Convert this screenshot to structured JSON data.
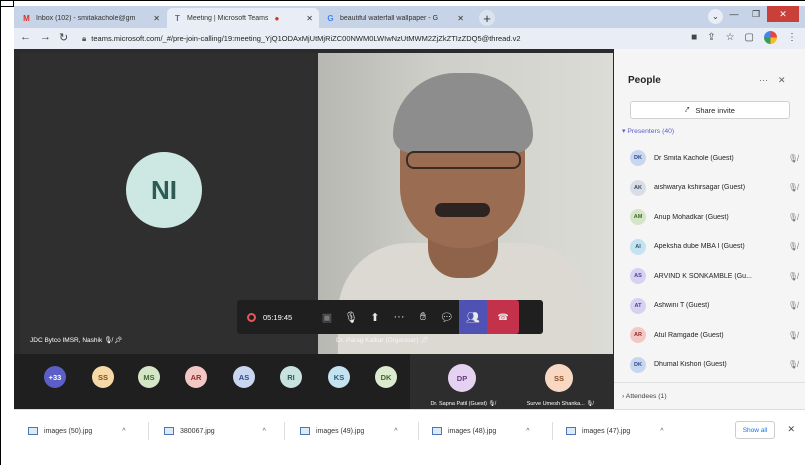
{
  "browser": {
    "tabs": [
      {
        "title": "Inbox (102) - smitakachole@gm",
        "icon": "gmail-icon",
        "color": "#d93025"
      },
      {
        "title": "Meeting | Microsoft Teams",
        "icon": "teams-icon",
        "color": "#5b5fc7",
        "active": true
      },
      {
        "title": "beautiful waterfall wallpaper - G",
        "icon": "google-icon",
        "color": "#4285f4"
      }
    ],
    "new_tab": "+",
    "url": "teams.microsoft.com/_#/pre-join-calling/19:meeting_YjQ1ODAxMjUtMjRiZC00NWM0LWIwNzUtMWM2ZjZkZTIzZDQ5@thread.v2"
  },
  "stage": {
    "main_avatar_initials": "NI",
    "left_tile_label": "JDC Bytco IMSR, Nashik",
    "right_tile_label": "Dr. Parag Kalkar (Organiser)"
  },
  "callbar": {
    "timer": "05:19:45"
  },
  "gallery": {
    "overflow": "+33",
    "avatars": [
      {
        "initials": "SS",
        "bg": "#f6d9a7",
        "fg": "#7a4f0b"
      },
      {
        "initials": "MS",
        "bg": "#d5e6c8",
        "fg": "#3f6b2c"
      },
      {
        "initials": "AR",
        "bg": "#f3c7c4",
        "fg": "#8a2f2a"
      },
      {
        "initials": "AS",
        "bg": "#c9d6ef",
        "fg": "#2c4a8a"
      },
      {
        "initials": "RI",
        "bg": "#c8e3df",
        "fg": "#2f5a54"
      },
      {
        "initials": "KS",
        "bg": "#c4e2ef",
        "fg": "#2a5a70"
      },
      {
        "initials": "DK",
        "bg": "#dcebcf",
        "fg": "#44662b"
      }
    ],
    "tiles": [
      {
        "initials": "DP",
        "name": "Dr. Sapna Patil (Guest)",
        "bg": "#e5d2f0",
        "fg": "#6a3c85"
      },
      {
        "initials": "SS",
        "name": "Surve Umesh Shanka...",
        "bg": "#f8d8c3",
        "fg": "#8a4a1e"
      }
    ]
  },
  "panel": {
    "title": "People",
    "more": "···",
    "close": "✕",
    "share_invite": "Share invite",
    "presenters_label": "Presenters (40)",
    "attendees_label": "Attendees (1)",
    "people": [
      {
        "initials": "DK",
        "name": "Dr Smita Kachole (Guest)",
        "bg": "#c9d6ef",
        "fg": "#2c4a8a"
      },
      {
        "initials": "AK",
        "name": "aishwarya kshirsagar (Guest)",
        "bg": "#d9dde6",
        "fg": "#3b4a63"
      },
      {
        "initials": "AM",
        "name": "Anup Mohadkar (Guest)",
        "bg": "#d5e6c8",
        "fg": "#3f6b2c"
      },
      {
        "initials": "AI",
        "name": "Apeksha dube MBA I (Guest)",
        "bg": "#c4e2ef",
        "fg": "#2a5a70"
      },
      {
        "initials": "AS",
        "name": "ARVIND K SONKAMBLE (Gu...",
        "bg": "#d6d2f2",
        "fg": "#4b3f99"
      },
      {
        "initials": "AT",
        "name": "Ashwini T (Guest)",
        "bg": "#d6d2f2",
        "fg": "#4b3f99"
      },
      {
        "initials": "AR",
        "name": "Atul Ramgade (Guest)",
        "bg": "#f3c7c4",
        "fg": "#8a2f2a"
      },
      {
        "initials": "DK",
        "name": "Dhumal Kishori (Guest)",
        "bg": "#c9d6ef",
        "fg": "#2c4a8a"
      }
    ]
  },
  "downloads": {
    "items": [
      "images (50).jpg",
      "380067.jpg",
      "images (49).jpg",
      "images (48).jpg",
      "images (47).jpg"
    ],
    "show_all": "Show all"
  }
}
